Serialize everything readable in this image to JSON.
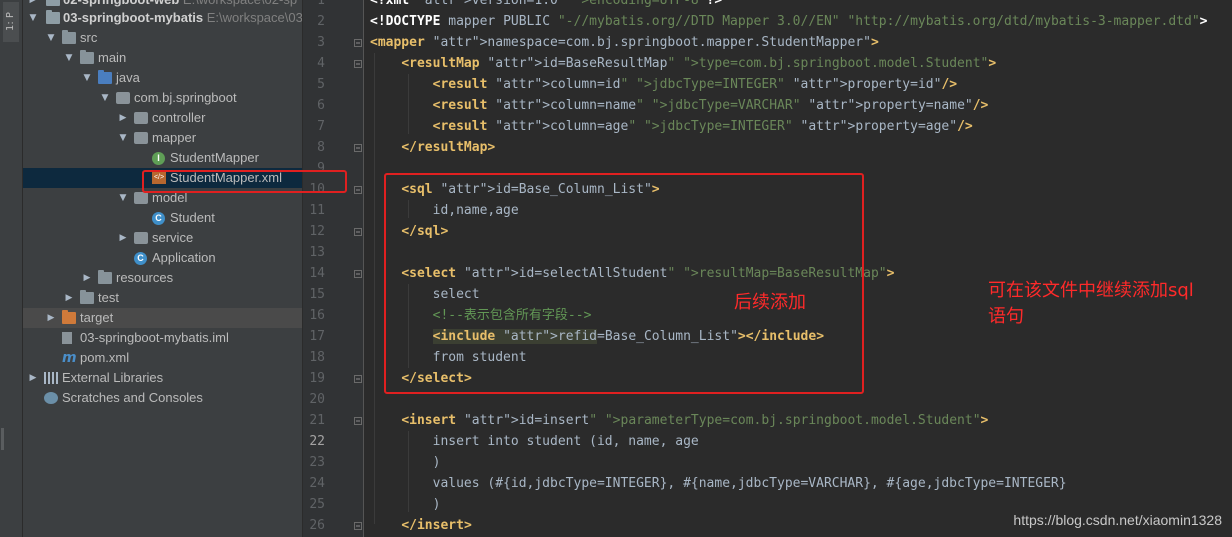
{
  "toolstrip": {
    "tab_label": "1: P"
  },
  "tree": {
    "rows": [
      {
        "name": "02-springboot-web",
        "path": "E:\\workspace\\02-sp",
        "indent": 0
      },
      {
        "name": "03-springboot-mybatis",
        "path": "E:\\workspace\\03"
      },
      {
        "name": "src"
      },
      {
        "name": "main"
      },
      {
        "name": "java"
      },
      {
        "name": "com.bj.springboot"
      },
      {
        "name": "controller"
      },
      {
        "name": "mapper"
      },
      {
        "name": "StudentMapper",
        "icon_letter": "I"
      },
      {
        "name": "StudentMapper.xml",
        "icon_letter": "</>"
      },
      {
        "name": "model"
      },
      {
        "name": "Student",
        "icon_letter": "C"
      },
      {
        "name": "service"
      },
      {
        "name": "Application",
        "icon_letter": "C"
      },
      {
        "name": "resources"
      },
      {
        "name": "test"
      },
      {
        "name": "target"
      },
      {
        "name": "03-springboot-mybatis.iml"
      },
      {
        "name": "pom.xml",
        "icon_letter": "m"
      },
      {
        "name": "External Libraries"
      },
      {
        "name": "Scratches and Consoles"
      }
    ]
  },
  "editor": {
    "current_line": "22",
    "lines": [
      {
        "n": "1",
        "t": "<?xml version=\"1.0\" encoding=\"UTF-8\"?>"
      },
      {
        "n": "2",
        "t": "<!DOCTYPE mapper PUBLIC \"-//mybatis.org//DTD Mapper 3.0//EN\" \"http://mybatis.org/dtd/mybatis-3-mapper.dtd\">"
      },
      {
        "n": "3",
        "t": "<mapper namespace=\"com.bj.springboot.mapper.StudentMapper\">"
      },
      {
        "n": "4",
        "t": "    <resultMap id=\"BaseResultMap\" type=\"com.bj.springboot.model.Student\">"
      },
      {
        "n": "5",
        "t": "        <result column=\"id\" jdbcType=\"INTEGER\" property=\"id\"/>"
      },
      {
        "n": "6",
        "t": "        <result column=\"name\" jdbcType=\"VARCHAR\" property=\"name\"/>"
      },
      {
        "n": "7",
        "t": "        <result column=\"age\" jdbcType=\"INTEGER\" property=\"age\"/>"
      },
      {
        "n": "8",
        "t": "    </resultMap>"
      },
      {
        "n": "9",
        "t": ""
      },
      {
        "n": "10",
        "t": "    <sql id=\"Base_Column_List\">"
      },
      {
        "n": "11",
        "t": "        id,name,age"
      },
      {
        "n": "12",
        "t": "    </sql>"
      },
      {
        "n": "13",
        "t": ""
      },
      {
        "n": "14",
        "t": "    <select id=\"selectAllStudent\" resultMap=\"BaseResultMap\">"
      },
      {
        "n": "15",
        "t": "        select"
      },
      {
        "n": "16",
        "t": "        <!--表示包含所有字段-->"
      },
      {
        "n": "17",
        "t": "        <include refid=\"Base_Column_List\"></include>"
      },
      {
        "n": "18",
        "t": "        from student"
      },
      {
        "n": "19",
        "t": "    </select>"
      },
      {
        "n": "20",
        "t": ""
      },
      {
        "n": "21",
        "t": "    <insert id=\"insert\" parameterType=\"com.bj.springboot.model.Student\">"
      },
      {
        "n": "22",
        "t": "        insert into student (id, name, age"
      },
      {
        "n": "23",
        "t": "        )"
      },
      {
        "n": "24",
        "t": "        values (#{id,jdbcType=INTEGER}, #{name,jdbcType=VARCHAR}, #{age,jdbcType=INTEGER}"
      },
      {
        "n": "25",
        "t": "        )"
      },
      {
        "n": "26",
        "t": "    </insert>"
      }
    ]
  },
  "annotations": {
    "inner_note": "后续添加",
    "outer_note_line1": "可在该文件中继续添加sql",
    "outer_note_line2": "语句"
  },
  "watermark": "https://blog.csdn.net/xiaomin1328",
  "colors": {
    "annotation_red": "#e02020",
    "xml_tag": "#e8bf6a",
    "xml_value": "#6a8759",
    "selection": "#0d293e"
  }
}
